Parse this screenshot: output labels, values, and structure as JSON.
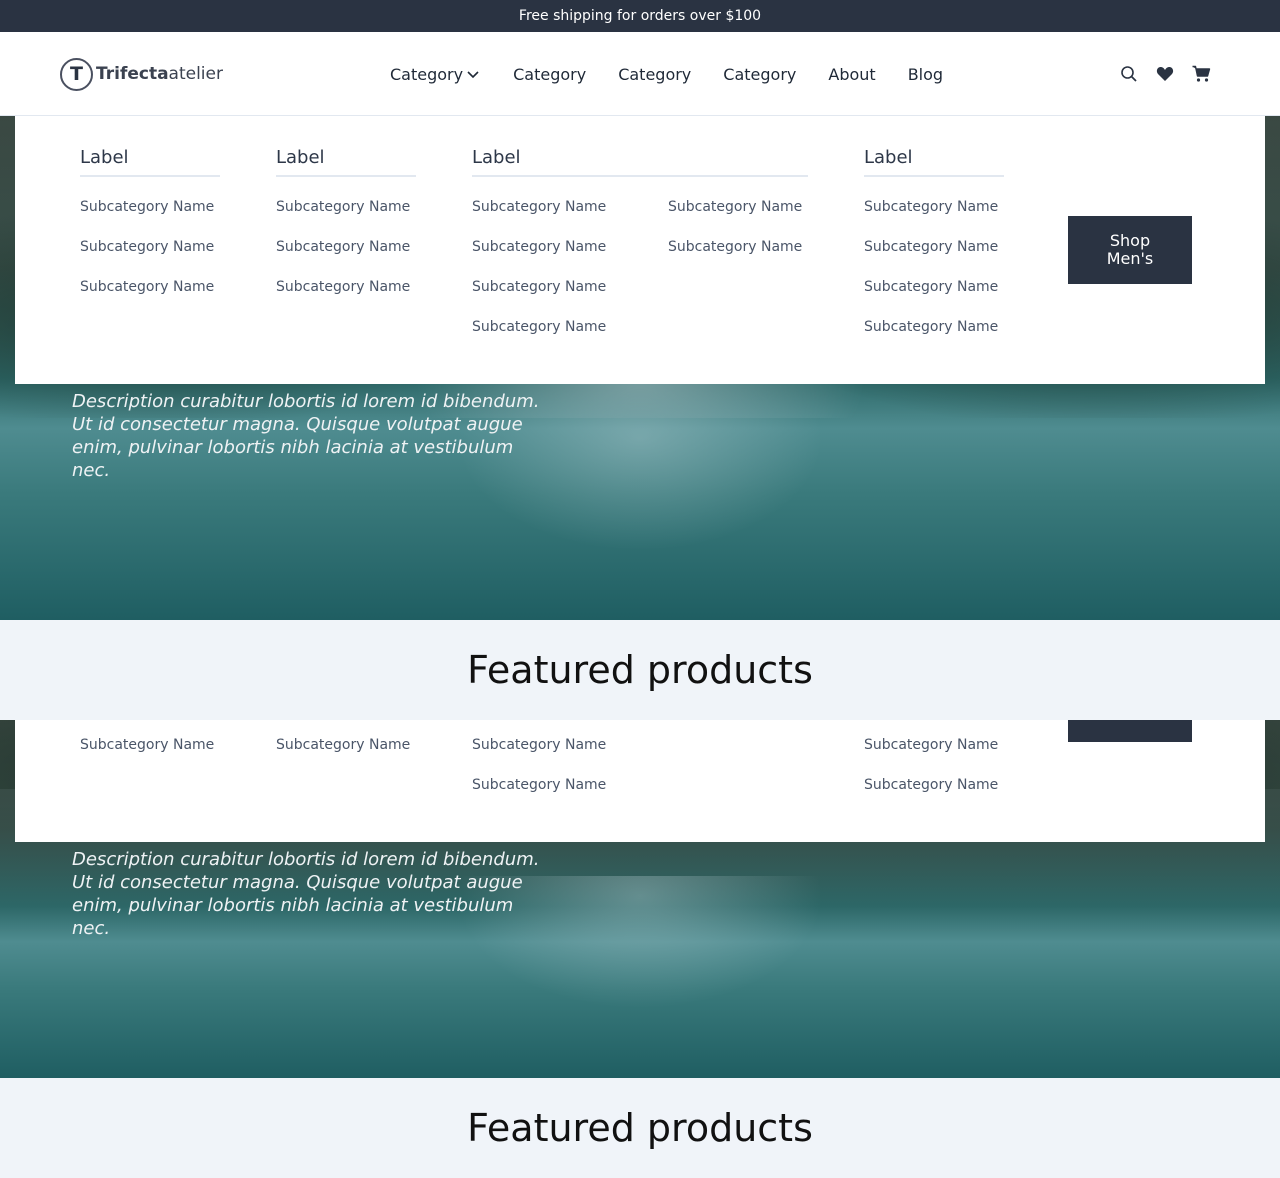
{
  "announcement": "Free shipping for orders over $100",
  "logo": {
    "mark": "T",
    "bold": "Trifecta",
    "rest": "atelier"
  },
  "nav": {
    "items": [
      "Category",
      "Category",
      "Category",
      "Category",
      "About",
      "Blog"
    ]
  },
  "icons": [
    "search-icon",
    "heart-icon",
    "cart-icon"
  ],
  "mega": {
    "labels": [
      "Label",
      "Label",
      "Label",
      "Label"
    ],
    "sub": "Subcategory Name",
    "shop_button": "Shop Men's"
  },
  "hero": {
    "description": "Description curabitur lobortis id lorem id bibendum. Ut id consectetur magna. Quisque volutpat augue enim, pulvinar lobortis nibh lacinia at vestibulum nec."
  },
  "featured": {
    "title": "Featured products"
  },
  "colors": {
    "dark": "#2a3342",
    "light_band": "#f0f4f9"
  }
}
